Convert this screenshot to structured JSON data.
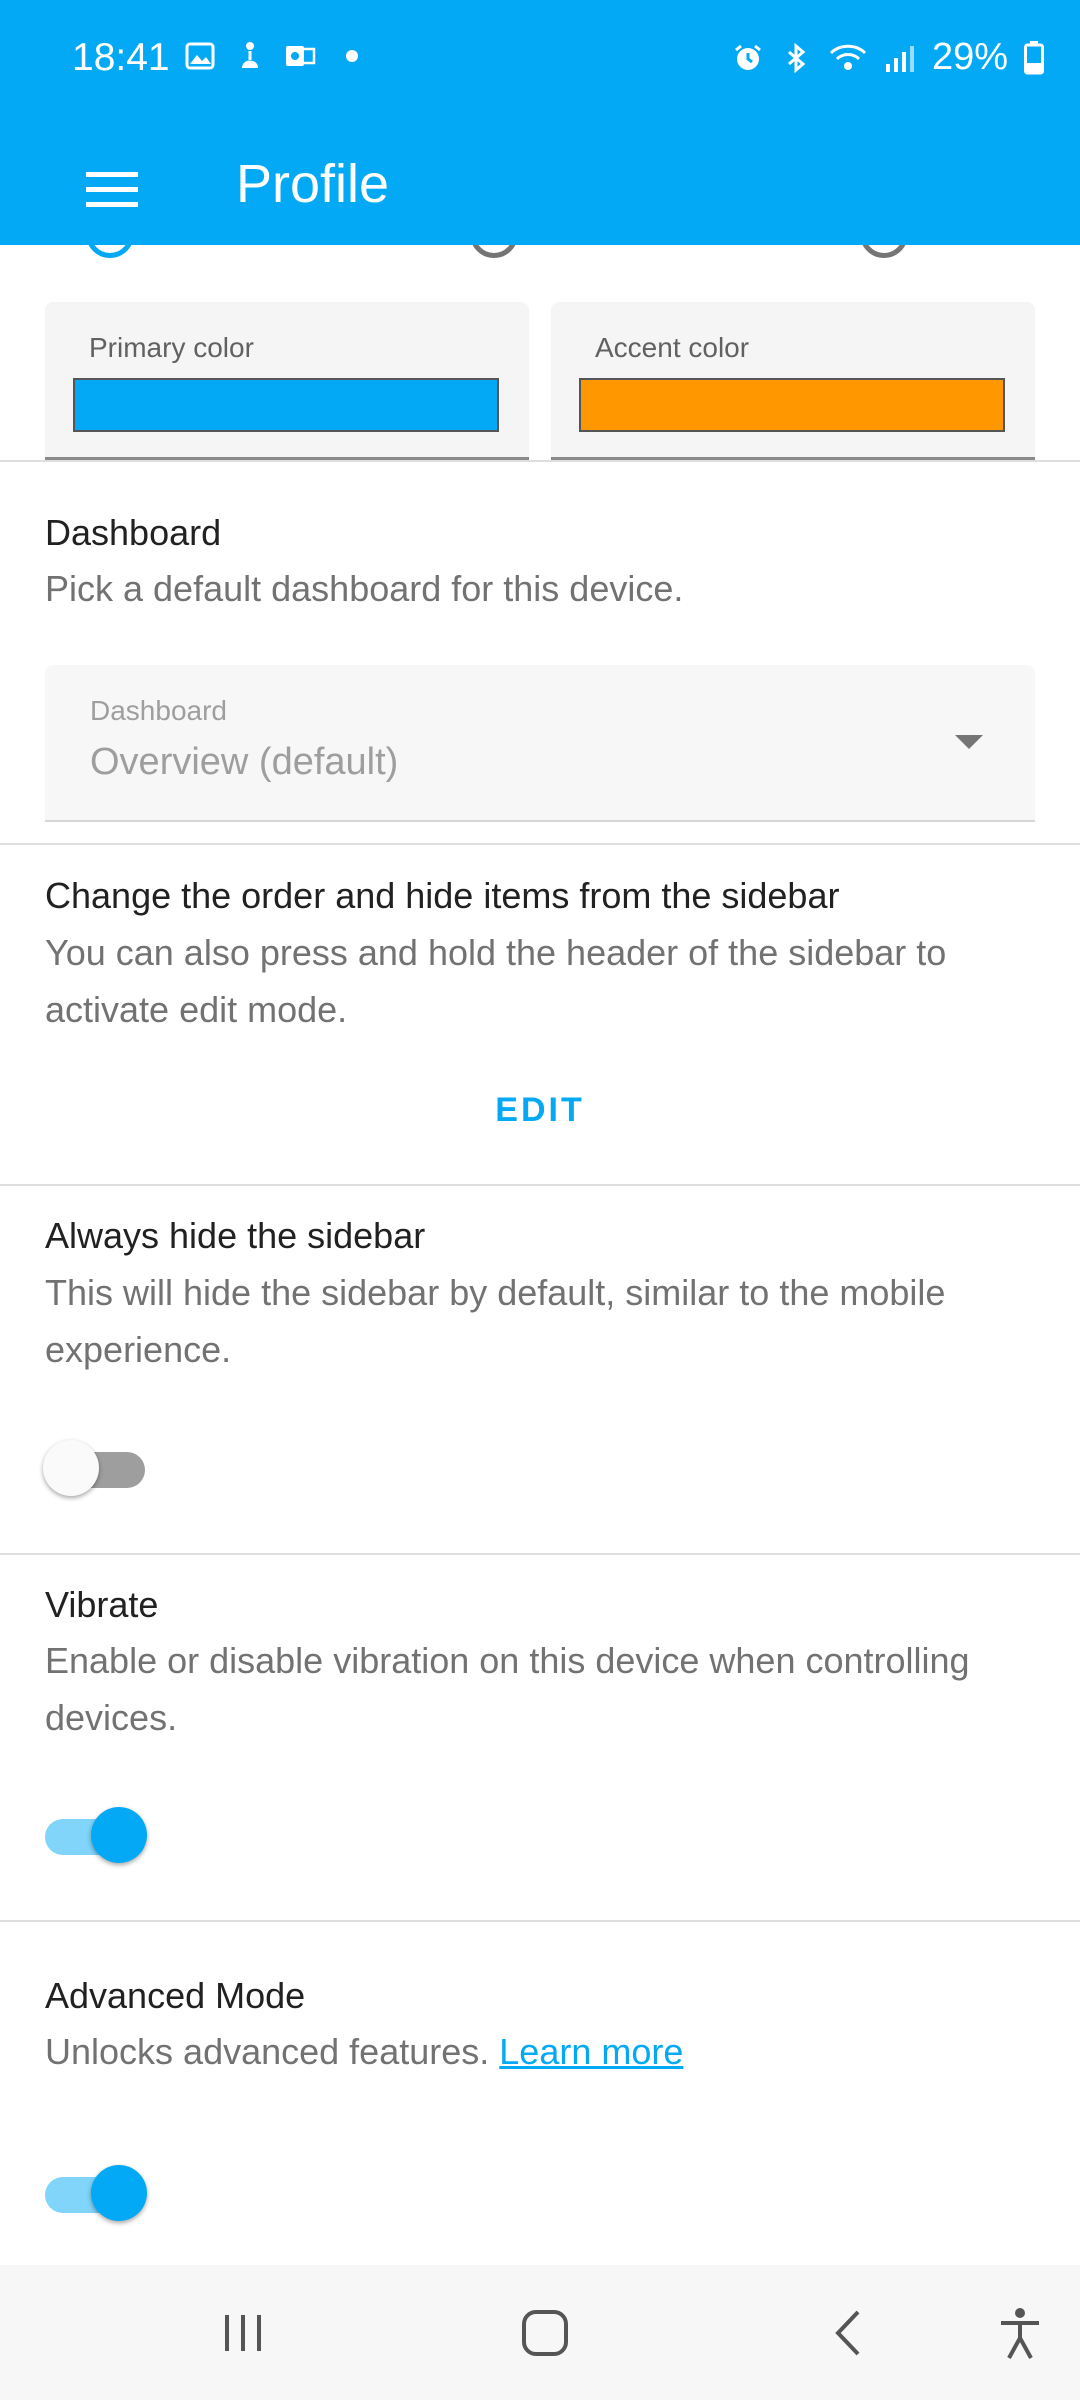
{
  "status_bar": {
    "time": "18:41",
    "battery": "29%",
    "icons": [
      "image-icon",
      "accessibility-notify-icon",
      "outlook-icon",
      "dot",
      "alarm-icon",
      "bluetooth-icon",
      "wifi-icon",
      "signal-icon",
      "battery-icon"
    ]
  },
  "app_bar": {
    "title": "Profile",
    "menu_icon": "hamburger-menu-icon"
  },
  "colors": {
    "primary_label": "Primary color",
    "primary_value": "#03a9f4",
    "accent_label": "Accent color",
    "accent_value": "#ff9800"
  },
  "dashboard": {
    "title": "Dashboard",
    "description": "Pick a default dashboard for this device.",
    "select_label": "Dashboard",
    "select_value": "Overview (default)"
  },
  "sidebar_order": {
    "title": "Change the order and hide items from the sidebar",
    "description": "You can also press and hold the header of the sidebar to activate edit mode.",
    "edit_label": "EDIT"
  },
  "hide_sidebar": {
    "title": "Always hide the sidebar",
    "description": "This will hide the sidebar by default, similar to the mobile experience.",
    "enabled": false
  },
  "vibrate": {
    "title": "Vibrate",
    "description": "Enable or disable vibration on this device when controlling devices.",
    "enabled": true
  },
  "advanced_mode": {
    "title": "Advanced Mode",
    "description": "Unlocks advanced features.",
    "link_label": "Learn more",
    "enabled": true
  },
  "theme_accent": "#03a9f4"
}
